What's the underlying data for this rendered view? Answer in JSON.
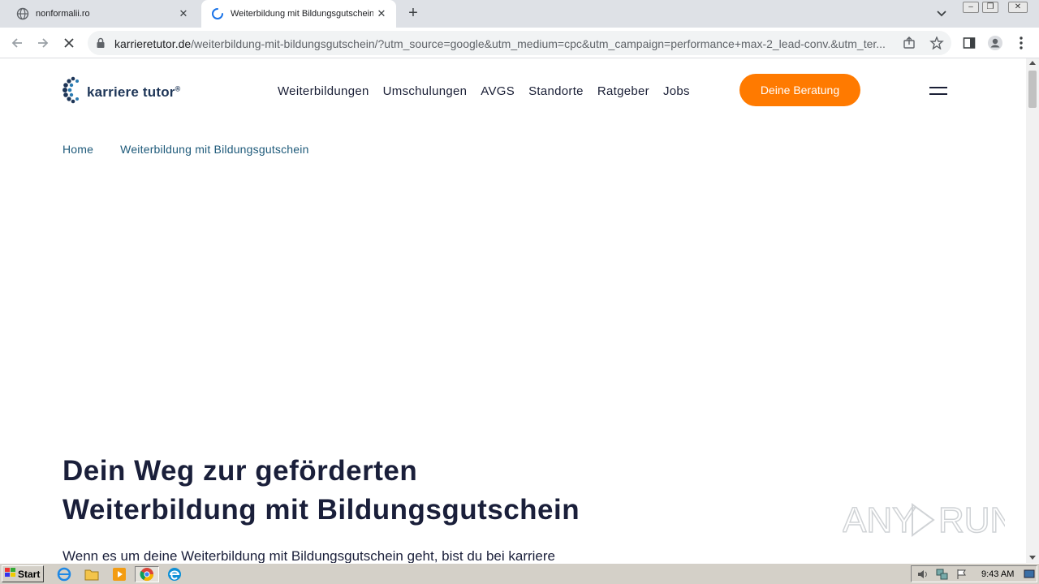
{
  "browser": {
    "tabs": [
      {
        "title": "nonformalii.ro",
        "active": false
      },
      {
        "title": "Weiterbildung mit Bildungsgutschein",
        "active": true
      }
    ],
    "url_host": "karrieretutor.de",
    "url_path": "/weiterbildung-mit-bildungsgutschein/?utm_source=google&utm_medium=cpc&utm_campaign=performance+max-2_lead-conv.&utm_ter..."
  },
  "site": {
    "logo_text": "karriere tutor",
    "logo_mark": "®",
    "nav": [
      "Weiterbildungen",
      "Umschulungen",
      "AVGS",
      "Standorte",
      "Ratgeber",
      "Jobs"
    ],
    "cta_label": "Deine Beratung",
    "breadcrumb": [
      "Home",
      "Weiterbildung mit Bildungsgutschein"
    ],
    "hero_title_line1": "Dein Weg zur geförderten",
    "hero_title_line2": "Weiterbildung mit Bildungsgutschein",
    "hero_text": "Wenn es um deine Weiterbildung mit Bildungsgutschein geht, bist du bei karriere"
  },
  "watermark": "ANY RUN",
  "taskbar": {
    "start_label": "Start",
    "clock": "9:43 AM"
  },
  "colors": {
    "accent": "#ff7a00",
    "brand": "#1d3557",
    "link": "#1e5a7a"
  }
}
